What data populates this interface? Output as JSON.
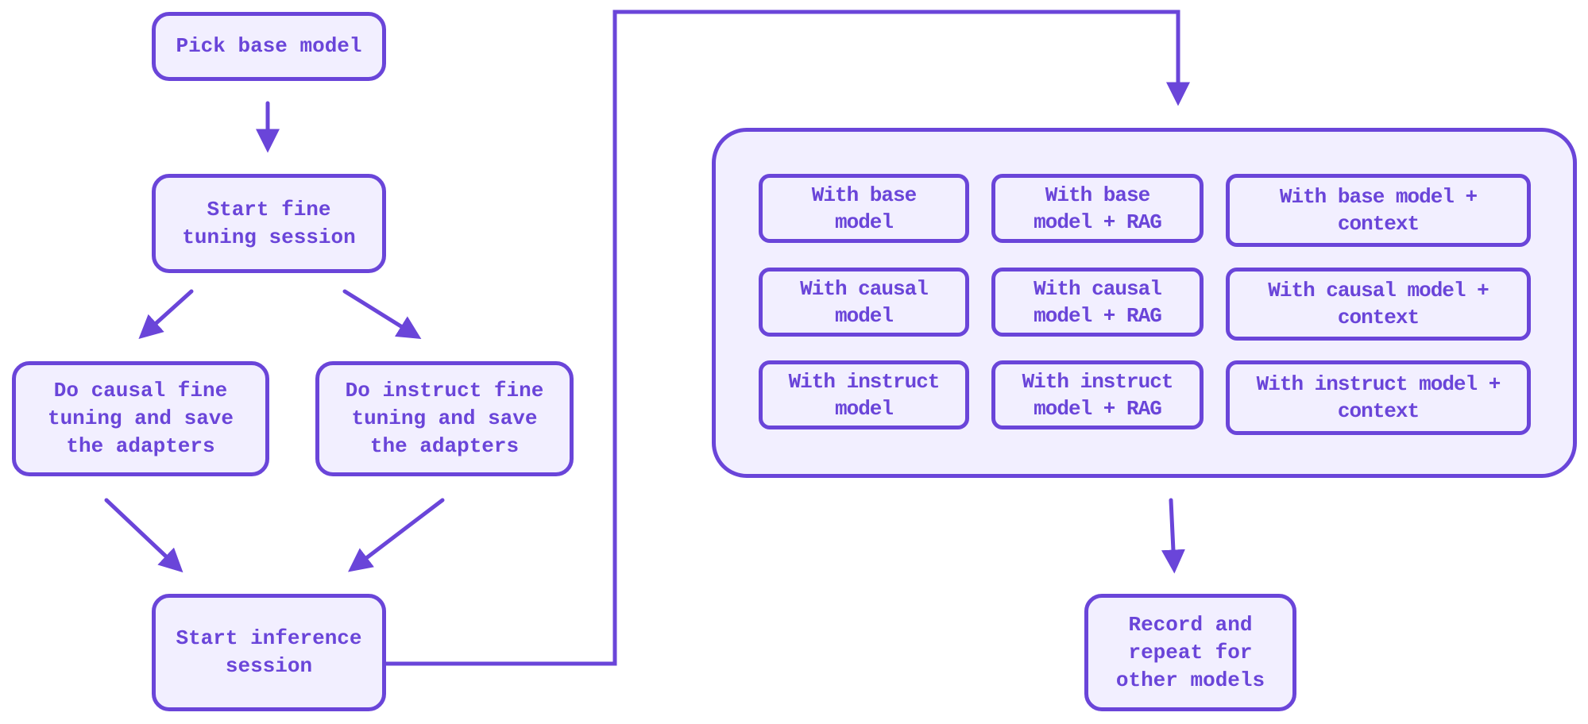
{
  "colors": {
    "stroke": "#6a45d9",
    "fill": "#f2efff"
  },
  "nodes": {
    "pick_base": "Pick base model",
    "start_fine_tuning": "Start fine\ntuning session",
    "causal_fine_tuning": "Do causal fine\ntuning and save\nthe adapters",
    "instruct_fine_tuning": "Do instruct fine\ntuning and save\nthe adapters",
    "start_inference": "Start inference\nsession",
    "record_repeat": "Record and\nrepeat for\nother models"
  },
  "grid": [
    [
      "With base\nmodel",
      "With base\nmodel + RAG",
      "With base model +\ncontext"
    ],
    [
      "With causal\nmodel",
      "With causal\nmodel + RAG",
      "With causal model +\ncontext"
    ],
    [
      "With instruct\nmodel",
      "With instruct\nmodel + RAG",
      "With instruct model +\ncontext"
    ]
  ]
}
